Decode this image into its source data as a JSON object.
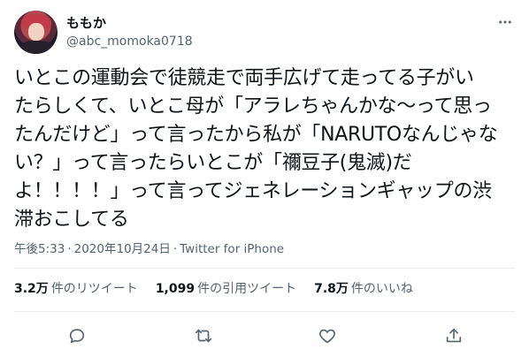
{
  "user": {
    "display_name": "ももか",
    "handle": "@abc_momoka0718"
  },
  "tweet": {
    "text": "いとこの運動会で徒競走で両手広げて走ってる子がい\nたらしくて、いとこ母が「アラレちゃんかな〜って思っ\nたんだけど」って言ったから私が「NARUTOなんじゃな\nい？」って言ったらいとこが「禰豆子(鬼滅)だ\nよ！！！！」って言ってジェネレーションギャップの渋\n滞おこしてる"
  },
  "meta": {
    "time": "午後5:33",
    "date": "2020年10月24日",
    "source": "Twitter for iPhone",
    "separator": "·"
  },
  "stats": {
    "retweets": {
      "value": "3.2万",
      "label": "件のリツイート"
    },
    "quotes": {
      "value": "1,099",
      "label": "件の引用ツイート"
    },
    "likes": {
      "value": "7.8万",
      "label": "件のいいね"
    }
  },
  "icons": {
    "reply": "reply-icon",
    "retweet": "retweet-icon",
    "like": "heart-icon",
    "share": "share-icon",
    "more": "more-icon"
  },
  "colors": {
    "text": "#0f1419",
    "secondary": "#536471",
    "divider": "#e6ecf0"
  }
}
